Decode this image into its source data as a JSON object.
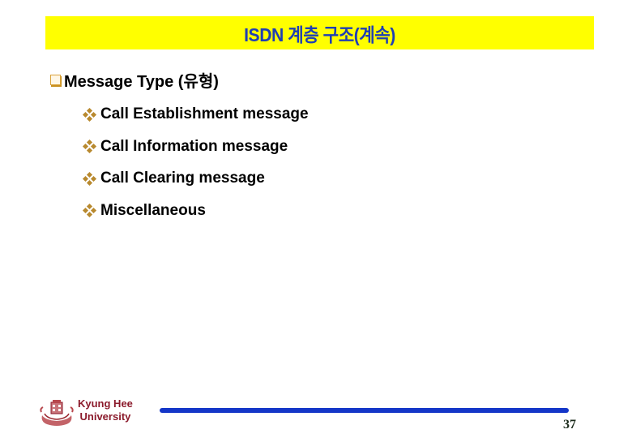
{
  "slide": {
    "title": "ISDN 계층 구조(계속)",
    "main_bullet": {
      "icon": "checkbox-square-icon",
      "text": "Message Type (유형)"
    },
    "sub_bullets": [
      {
        "icon": "four-diamond-icon",
        "text": "Call Establishment message"
      },
      {
        "icon": "four-diamond-icon",
        "text": "Call Information message"
      },
      {
        "icon": "four-diamond-icon",
        "text": "Call Clearing message"
      },
      {
        "icon": "four-diamond-icon",
        "text": "Miscellaneous"
      }
    ]
  },
  "footer": {
    "logo": "university-seal-icon",
    "university_line1": "Kyung Hee",
    "university_line2": "University",
    "page_number": "37"
  },
  "colors": {
    "banner_background": "#ffff00",
    "title_text": "#1f3fb4",
    "bullet_accent": "#b8892e",
    "university_text": "#8b1a2b",
    "footer_bar": "#1436c8"
  }
}
